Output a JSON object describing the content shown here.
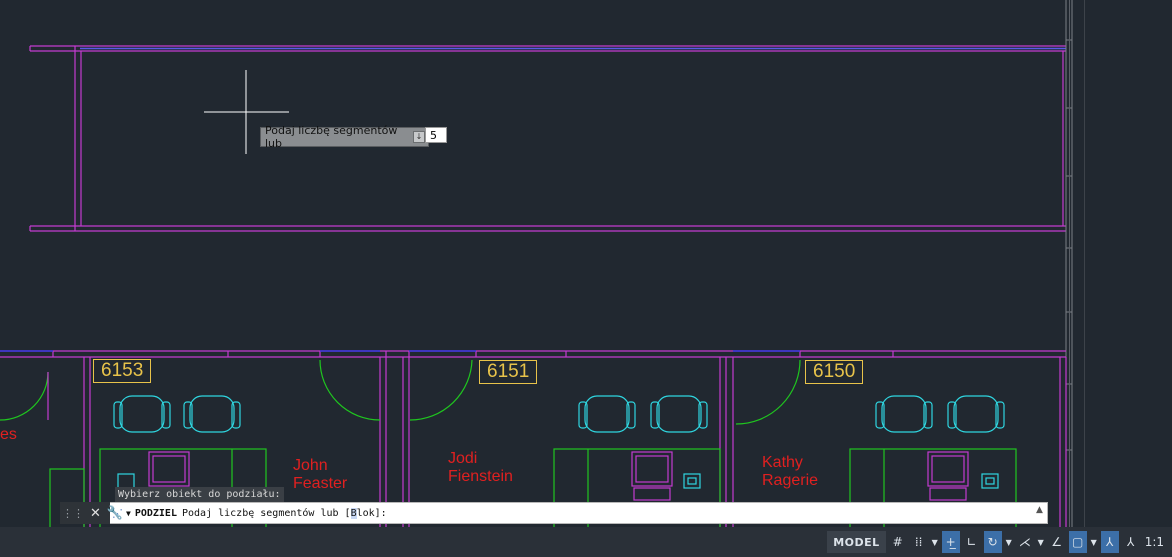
{
  "drawing": {
    "rooms": [
      {
        "number": "6153"
      },
      {
        "number": "6151"
      },
      {
        "number": "6150"
      }
    ],
    "occupants": [
      {
        "name": "John\nFeaster"
      },
      {
        "name": "Jodi\nFienstein"
      },
      {
        "name": "Kathy\nRagerie"
      }
    ],
    "partial_text": "es"
  },
  "prompt_tooltip": {
    "label": "Podaj liczbę segmentów lub",
    "value": "5"
  },
  "command_hint": "Wybierz obiekt do podziału:",
  "command_line": {
    "command": "PODZIEL",
    "prompt": "Podaj liczbę segmentów lub [",
    "option_hotkey": "B",
    "option_rest": "lok",
    "suffix": "]:"
  },
  "status_bar": {
    "model_label": "MODEL",
    "scale_label": "1:1"
  },
  "colors": {
    "background": "#212830",
    "walls": "#c43bd0",
    "furniture_cyan": "#2fd6e0",
    "furniture_green": "#1fc61f",
    "room_label": "#e8c34a",
    "occupant_text": "#e02020",
    "window_blue": "#3a3ae0",
    "active_toggle": "#3c6fa8"
  }
}
